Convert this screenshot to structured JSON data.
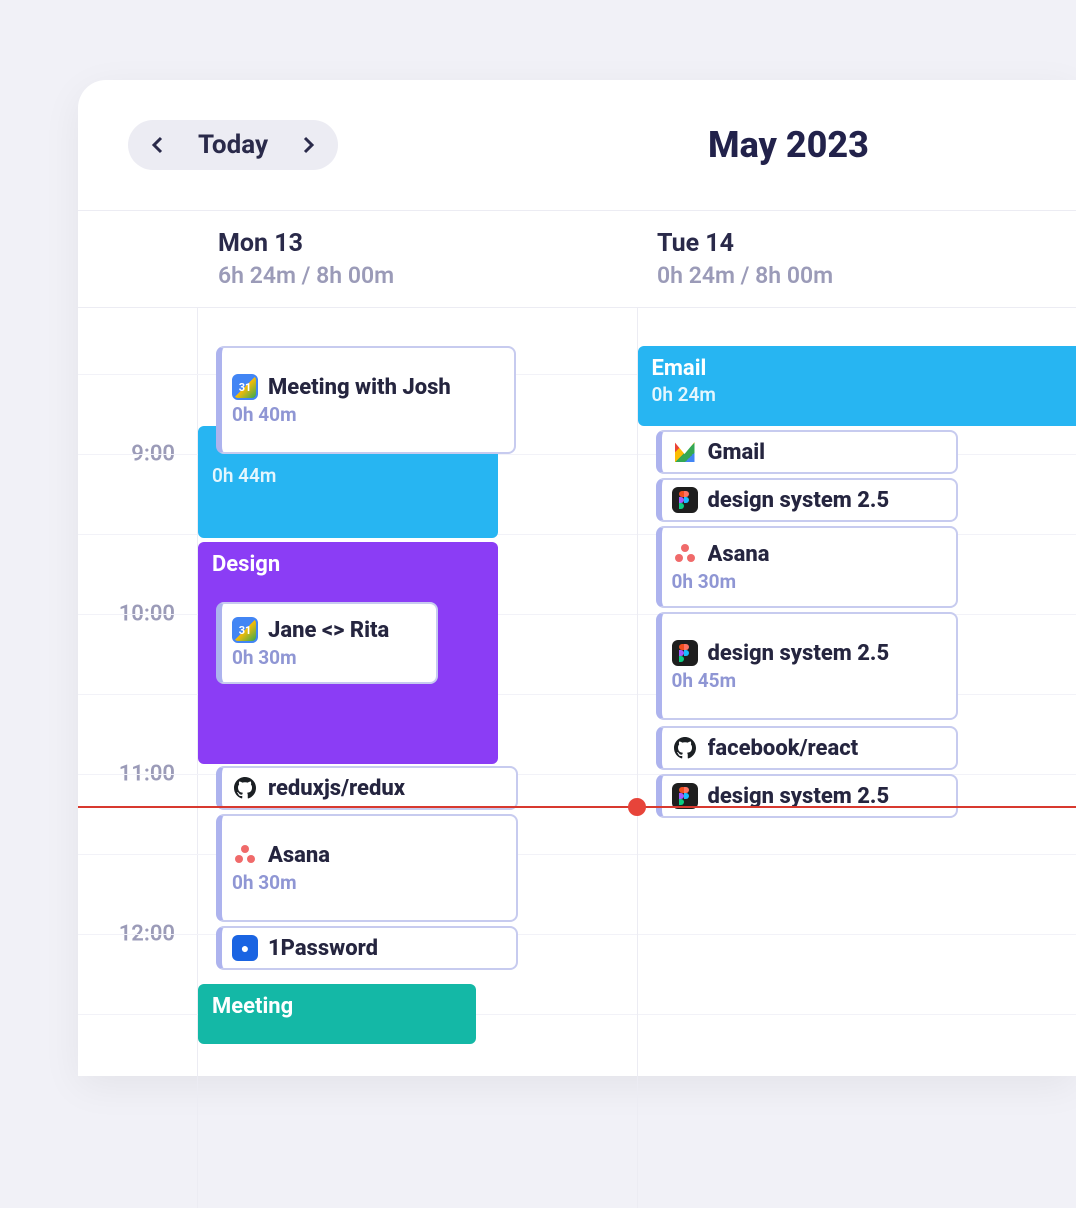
{
  "header": {
    "today_label": "Today",
    "month_title": "May 2023"
  },
  "days": [
    {
      "label": "Mon 13",
      "hours": "6h 24m / 8h 00m"
    },
    {
      "label": "Tue 14",
      "hours": "0h 24m / 8h 00m"
    }
  ],
  "time_labels": [
    "9:00",
    "10:00",
    "11:00",
    "12:00"
  ],
  "mon": {
    "block1_dur": "0h 44m",
    "meeting_josh": "Meeting with Josh",
    "meeting_josh_dur": "0h 40m",
    "design_label": "Design",
    "jane_rita": "Jane <> Rita",
    "jane_rita_dur": "0h 30m",
    "redux": "reduxjs/redux",
    "asana": "Asana",
    "asana_dur": "0h 30m",
    "onepw": "1Password",
    "meeting_label": "Meeting"
  },
  "tue": {
    "email_label": "Email",
    "email_dur": "0h 24m",
    "gmail": "Gmail",
    "ds1": "design system 2.5",
    "asana": "Asana",
    "asana_dur": "0h 30m",
    "ds2": "design system 2.5",
    "ds2_dur": "0h 45m",
    "fbreact": "facebook/react",
    "ds3": "design system 2.5"
  }
}
